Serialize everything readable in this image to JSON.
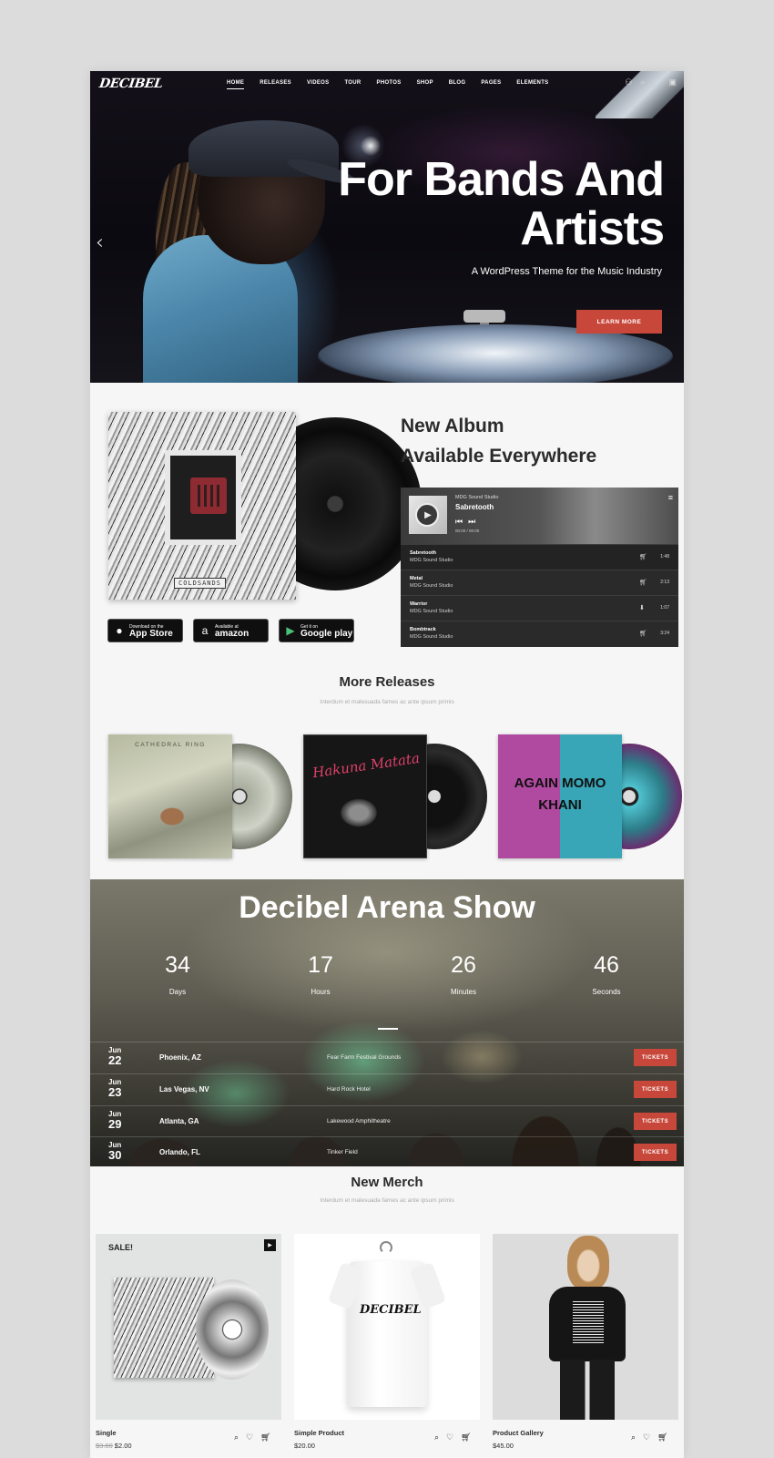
{
  "header": {
    "logo": "DECIBEL",
    "nav": [
      "HOME",
      "RELEASES",
      "VIDEOS",
      "TOUR",
      "PHOTOS",
      "SHOP",
      "BLOG",
      "PAGES",
      "ELEMENTS"
    ],
    "icons": [
      "user-icon",
      "search-icon",
      "heart-icon",
      "bag-icon"
    ]
  },
  "hero": {
    "title": "For Bands And Artists",
    "subtitle": "A WordPress Theme for the Music Industry",
    "cta": "LEARN MORE",
    "prev_arrow": "‹"
  },
  "album": {
    "cover_label": "COLDSANDS",
    "heading_line1": "New Album",
    "heading_line2": "Available Everywhere",
    "badges": [
      {
        "small": "Download on the",
        "large": "App Store",
        "icon": "apple-icon"
      },
      {
        "small": "Available at",
        "large": "amazon",
        "icon": "amazon-icon"
      },
      {
        "small": "Get it on",
        "large": "Google play",
        "icon": "google-play-icon"
      }
    ]
  },
  "player": {
    "studio": "MDG Sound Studio",
    "track": "Sabretooth",
    "time": "00:00 / 00:00",
    "playlist": [
      {
        "title": "Sabretooth",
        "artist": "MDG Sound Studio",
        "duration": "1:48",
        "icon": "cart-icon"
      },
      {
        "title": "Metal",
        "artist": "MDG Sound Studio",
        "duration": "2:13",
        "icon": "cart-icon"
      },
      {
        "title": "Warrior",
        "artist": "MDG Sound Studio",
        "duration": "1:07",
        "icon": "download-icon"
      },
      {
        "title": "Bombtrack",
        "artist": "MDG Sound Studio",
        "duration": "3:24",
        "icon": "cart-icon"
      }
    ]
  },
  "releases": {
    "title": "More Releases",
    "subtitle": "Interdum et malesuada fames ac ante ipsum primis",
    "items": [
      {
        "label": "CATHEDRAL RING"
      },
      {
        "label": "Hakuna Matata"
      },
      {
        "label": "AGAIN MOMO KHANI"
      }
    ]
  },
  "arena": {
    "title": "Decibel Arena Show",
    "counters": [
      {
        "value": "34",
        "unit": "Days"
      },
      {
        "value": "17",
        "unit": "Hours"
      },
      {
        "value": "26",
        "unit": "Minutes"
      },
      {
        "value": "46",
        "unit": "Seconds"
      }
    ],
    "shows": [
      {
        "month": "Jun",
        "day": "22",
        "city": "Phoenix, AZ",
        "venue": "Fear Farm Festival Grounds",
        "button": "TICKETS"
      },
      {
        "month": "Jun",
        "day": "23",
        "city": "Las Vegas, NV",
        "venue": "Hard Rock Hotel",
        "button": "TICKETS"
      },
      {
        "month": "Jun",
        "day": "29",
        "city": "Atlanta, GA",
        "venue": "Lakewood Amphitheatre",
        "button": "TICKETS"
      },
      {
        "month": "Jun",
        "day": "30",
        "city": "Orlando, FL",
        "venue": "Tinker Field",
        "button": "TICKETS"
      }
    ]
  },
  "merch": {
    "title": "New Merch",
    "subtitle": "Interdum et malesuada fames ac ante ipsum primis",
    "sale_label": "SALE!",
    "shirt_print": "DECIBEL",
    "items": [
      {
        "name": "Single",
        "old_price": "$3.60",
        "price": "$2.00"
      },
      {
        "name": "Simple Product",
        "old_price": "",
        "price": "$20.00"
      },
      {
        "name": "Product Gallery",
        "old_price": "",
        "price": "$45.00"
      }
    ]
  },
  "colors": {
    "accent": "#c8473b",
    "dark": "#2b2b2b",
    "page": "#f6f6f6",
    "outer": "#dcdcdc"
  }
}
